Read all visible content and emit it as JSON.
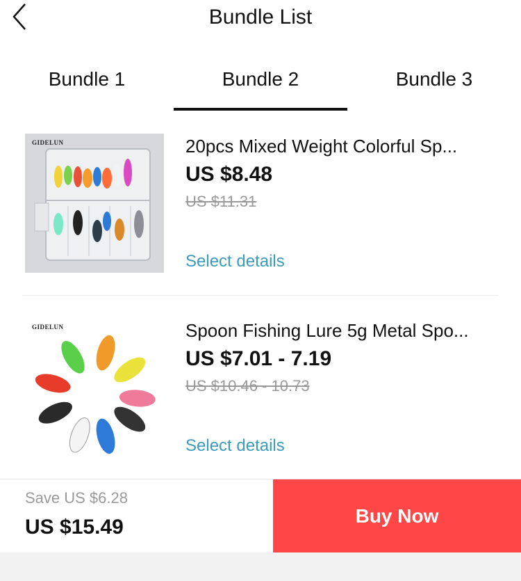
{
  "header": {
    "title": "Bundle List"
  },
  "tabs": [
    {
      "label": "Bundle 1"
    },
    {
      "label": "Bundle 2"
    },
    {
      "label": "Bundle 3"
    }
  ],
  "active_tab": "Bundle 2",
  "items": [
    {
      "title": "20pcs Mixed Weight Colorful Sp...",
      "price": "US $8.48",
      "old_price": "US $11.31",
      "select_label": "Select details",
      "brand": "GIDELUN"
    },
    {
      "title": "Spoon Fishing Lure 5g Metal Spo...",
      "price": "US $7.01 - 7.19",
      "old_price": "US $10.46 - 10.73",
      "select_label": "Select details",
      "brand": "GIDELUN"
    }
  ],
  "footer": {
    "save": "Save US $6.28",
    "total": "US $15.49",
    "buy_label": "Buy Now"
  },
  "colors": {
    "accent": "#ff4747",
    "link": "#3a9bbd",
    "tab_indicator": "#111111"
  }
}
